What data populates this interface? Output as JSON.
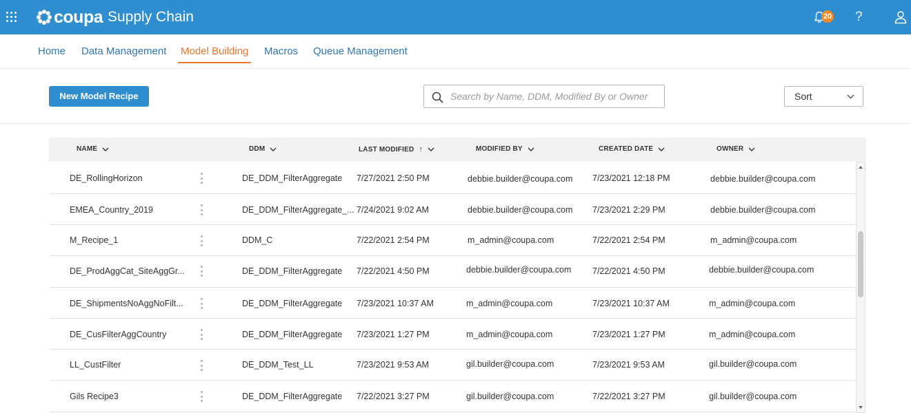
{
  "app": {
    "logo_text": "coupa",
    "product": "Supply Chain",
    "notification_count": "20",
    "help_glyph": "?"
  },
  "nav": {
    "items": [
      {
        "label": "Home"
      },
      {
        "label": "Data Management"
      },
      {
        "label": "Model Building",
        "active": true
      },
      {
        "label": "Macros"
      },
      {
        "label": "Queue Management"
      }
    ]
  },
  "toolbar": {
    "new_button": "New Model Recipe",
    "search_placeholder": "Search by Name, DDM, Modified By or Owner",
    "sort_label": "Sort"
  },
  "table": {
    "headers": {
      "name": "NAME",
      "ddm": "DDM",
      "last_modified": "LAST MODIFIED",
      "modified_by": "MODIFIED BY",
      "created_date": "CREATED DATE",
      "owner": "OWNER"
    },
    "sort_indicator": "↑",
    "rows": [
      {
        "name": "DE_RollingHorizon",
        "ddm": "DE_DDM_FilterAggregate",
        "last_modified": "7/27/2021 2:50 PM",
        "modified_by": "debbie.builder@coupa.com",
        "created_date": "7/23/2021 12:18 PM",
        "owner": "debbie.builder@coupa.com"
      },
      {
        "name": "EMEA_Country_2019",
        "ddm": "DE_DDM_FilterAggregate_...",
        "last_modified": "7/24/2021 9:02 AM",
        "modified_by": "debbie.builder@coupa.com",
        "created_date": "7/23/2021 2:29 PM",
        "owner": "debbie.builder@coupa.com"
      },
      {
        "name": "M_Recipe_1",
        "ddm": "DDM_C",
        "last_modified": "7/22/2021 2:54 PM",
        "modified_by": "m_admin@coupa.com",
        "created_date": "7/22/2021 2:54 PM",
        "owner": "m_admin@coupa.com"
      },
      {
        "name": "DE_ProdAggCat_SiteAggGr...",
        "ddm": "DE_DDM_FilterAggregate",
        "last_modified": "7/22/2021 4:50 PM",
        "modified_by": "debbie.builder@coupa.com",
        "created_date": "7/22/2021 4:50 PM",
        "owner": "debbie.builder@coupa.com"
      },
      {
        "name": "DE_ShipmentsNoAggNoFilt...",
        "ddm": "DE_DDM_FilterAggregate",
        "last_modified": "7/23/2021 10:37 AM",
        "modified_by": "m_admin@coupa.com",
        "created_date": "7/23/2021 10:37 AM",
        "owner": "m_admin@coupa.com"
      },
      {
        "name": "DE_CusFilterAggCountry",
        "ddm": "DE_DDM_FilterAggregate",
        "last_modified": "7/23/2021 1:27 PM",
        "modified_by": "m_admin@coupa.com",
        "created_date": "7/23/2021 1:27 PM",
        "owner": "m_admin@coupa.com"
      },
      {
        "name": "LL_CustFilter",
        "ddm": "DE_DDM_Test_LL",
        "last_modified": "7/23/2021 9:53 AM",
        "modified_by": "gil.builder@coupa.com",
        "created_date": "7/23/2021 9:53 AM",
        "owner": "gil.builder@coupa.com"
      },
      {
        "name": "Gils Recipe3",
        "ddm": "DE_DDM_FilterAggregate",
        "last_modified": "7/22/2021 3:27 PM",
        "modified_by": "gil.builder@coupa.com",
        "created_date": "7/22/2021 3:27 PM",
        "owner": "gil.builder@coupa.com"
      }
    ]
  },
  "icons": {
    "apps": "apps-grid-icon",
    "bell": "bell-icon",
    "help": "help-icon",
    "user": "user-icon",
    "search": "search-icon",
    "sort_chevron": "chevron-down-icon",
    "row_menu": "kebab-menu-icon"
  },
  "colors": {
    "brand": "#2f8ed0",
    "active_nav": "#e8762c",
    "link": "#2f77b5",
    "badge": "#f08a24"
  }
}
